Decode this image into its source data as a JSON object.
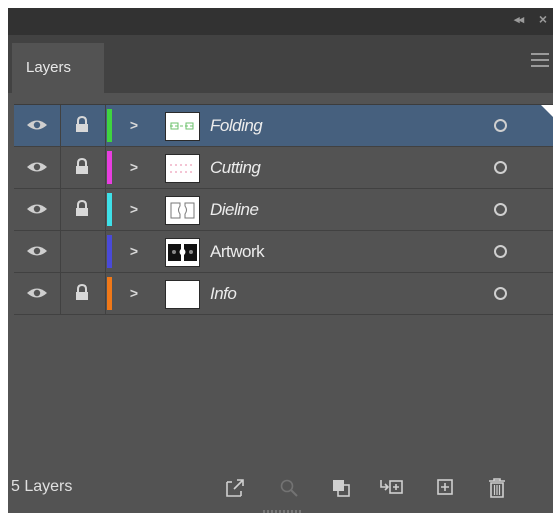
{
  "panel": {
    "tab_label": "Layers",
    "layer_count": "5 Layers"
  },
  "layers": [
    {
      "name": "Folding",
      "color": "#3fd43f",
      "locked": true,
      "selected": true,
      "italic": true
    },
    {
      "name": "Cutting",
      "color": "#e83ee0",
      "locked": true,
      "selected": false,
      "italic": true
    },
    {
      "name": "Dieline",
      "color": "#3ee0e8",
      "locked": true,
      "selected": false,
      "italic": true
    },
    {
      "name": "Artwork",
      "color": "#4a4ad8",
      "locked": false,
      "selected": false,
      "italic": false
    },
    {
      "name": "Info",
      "color": "#f07818",
      "locked": true,
      "selected": false,
      "italic": true
    }
  ],
  "footer_icons": [
    "collect-for-export-icon",
    "locate-object-icon",
    "make-clipping-mask-icon",
    "create-sublayer-icon",
    "create-layer-icon",
    "delete-layer-icon"
  ]
}
